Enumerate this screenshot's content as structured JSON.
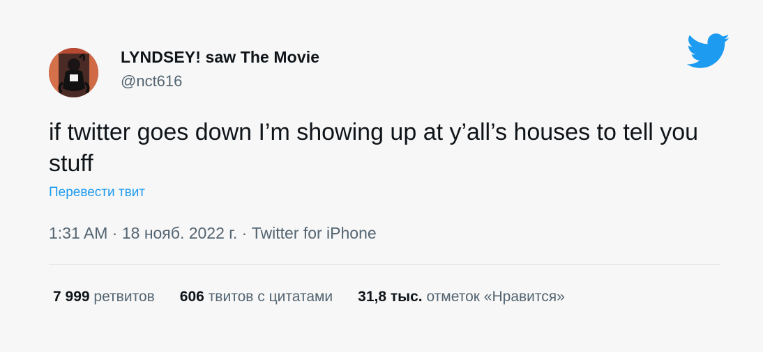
{
  "author": {
    "display_name": "LYNDSEY! saw The Movie",
    "handle": "@nct616",
    "avatar_icon": "character-avatar-icon"
  },
  "brand": {
    "logo_icon": "twitter-bird-icon",
    "color": "#1d9bf0"
  },
  "tweet": {
    "text": "if twitter goes down I’m showing up at y’all’s houses to tell you stuff",
    "translate_link": "Перевести твит"
  },
  "meta": {
    "time": "1:31 AM",
    "date": "18 нояб. 2022 г.",
    "source": "Twitter for iPhone"
  },
  "stats": [
    {
      "count": "7 999",
      "label": "ретвитов"
    },
    {
      "count": "606",
      "label": "твитов с цитатами"
    },
    {
      "count": "31,8 тыс.",
      "label": "отметок «Нравится»"
    }
  ],
  "colors": {
    "background": "#f7f7f7",
    "text_primary": "#0f1419",
    "text_secondary": "#536471",
    "link": "#1d9bf0"
  }
}
